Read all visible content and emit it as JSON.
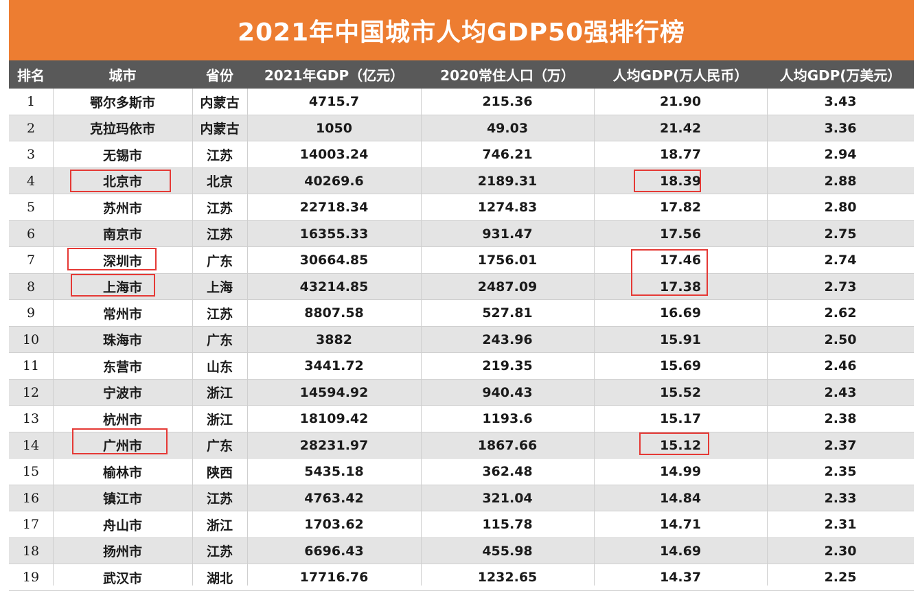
{
  "title": "2021年中国城市人均GDP50强排行榜",
  "colors": {
    "title_bg": "#ed7d31",
    "header_bg": "#595959",
    "stripe": "#e4e4e4",
    "highlight": "#e53935"
  },
  "headers": [
    "排名",
    "城市",
    "省份",
    "2021年GDP（亿元）",
    "2020常住人口（万）",
    "人均GDP(万人民币）",
    "人均GDP(万美元）"
  ],
  "rows": [
    [
      "1",
      "鄂尔多斯市",
      "内蒙古",
      "4715.7",
      "215.36",
      "21.90",
      "3.43"
    ],
    [
      "2",
      "克拉玛依市",
      "内蒙古",
      "1050",
      "49.03",
      "21.42",
      "3.36"
    ],
    [
      "3",
      "无锡市",
      "江苏",
      "14003.24",
      "746.21",
      "18.77",
      "2.94"
    ],
    [
      "4",
      "北京市",
      "北京",
      "40269.6",
      "2189.31",
      "18.39",
      "2.88"
    ],
    [
      "5",
      "苏州市",
      "江苏",
      "22718.34",
      "1274.83",
      "17.82",
      "2.80"
    ],
    [
      "6",
      "南京市",
      "江苏",
      "16355.33",
      "931.47",
      "17.56",
      "2.75"
    ],
    [
      "7",
      "深圳市",
      "广东",
      "30664.85",
      "1756.01",
      "17.46",
      "2.74"
    ],
    [
      "8",
      "上海市",
      "上海",
      "43214.85",
      "2487.09",
      "17.38",
      "2.73"
    ],
    [
      "9",
      "常州市",
      "江苏",
      "8807.58",
      "527.81",
      "16.69",
      "2.62"
    ],
    [
      "10",
      "珠海市",
      "广东",
      "3882",
      "243.96",
      "15.91",
      "2.50"
    ],
    [
      "11",
      "东营市",
      "山东",
      "3441.72",
      "219.35",
      "15.69",
      "2.46"
    ],
    [
      "12",
      "宁波市",
      "浙江",
      "14594.92",
      "940.43",
      "15.52",
      "2.43"
    ],
    [
      "13",
      "杭州市",
      "浙江",
      "18109.42",
      "1193.6",
      "15.17",
      "2.38"
    ],
    [
      "14",
      "广州市",
      "广东",
      "28231.97",
      "1867.66",
      "15.12",
      "2.37"
    ],
    [
      "15",
      "榆林市",
      "陕西",
      "5435.18",
      "362.48",
      "14.99",
      "2.35"
    ],
    [
      "16",
      "镇江市",
      "江苏",
      "4763.42",
      "321.04",
      "14.84",
      "2.33"
    ],
    [
      "17",
      "舟山市",
      "浙江",
      "1703.62",
      "115.78",
      "14.71",
      "2.31"
    ],
    [
      "18",
      "扬州市",
      "江苏",
      "6696.43",
      "455.98",
      "14.69",
      "2.30"
    ],
    [
      "19",
      "武汉市",
      "湖北",
      "17716.76",
      "1232.65",
      "14.37",
      "2.25"
    ]
  ],
  "highlighted_rows": [
    4,
    7,
    8,
    14
  ]
}
